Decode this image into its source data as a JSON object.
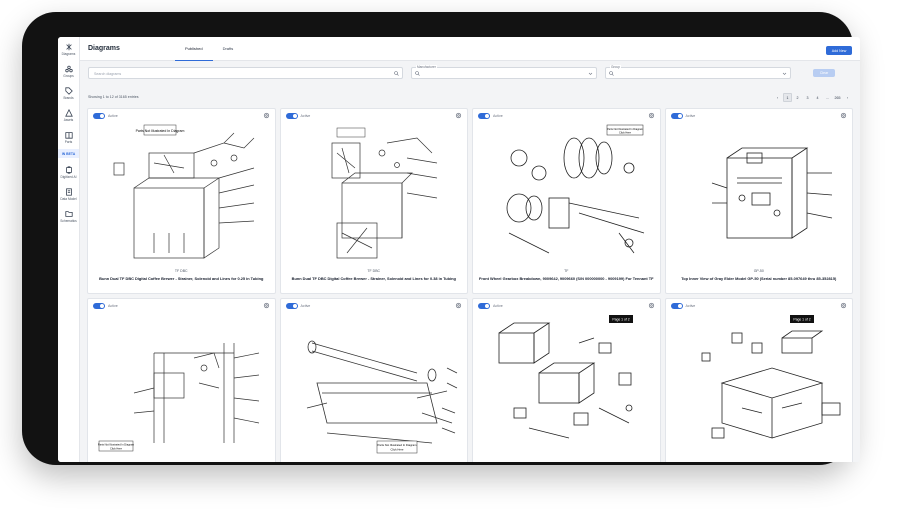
{
  "sidebar": {
    "items": [
      {
        "label": "Diagrams",
        "icon": "diagram-icon"
      },
      {
        "label": "Groups",
        "icon": "groups-icon"
      },
      {
        "label": "Brands",
        "icon": "tag-icon"
      },
      {
        "label": "Assets",
        "icon": "asset-icon"
      },
      {
        "label": "Parts",
        "icon": "book-icon"
      }
    ],
    "beta_label": "IN BETA",
    "beta_items": [
      {
        "label": "Digitized AI",
        "icon": "ai-icon"
      },
      {
        "label": "Data Model",
        "icon": "data-model-icon"
      },
      {
        "label": "Schematics",
        "icon": "folder-icon"
      }
    ]
  },
  "header": {
    "title": "Diagrams",
    "tabs": [
      {
        "label": "Published",
        "active": true
      },
      {
        "label": "Drafts",
        "active": false
      }
    ],
    "add_button": "Add New"
  },
  "filters": {
    "search_placeholder": "Search diagrams",
    "manufacturer_label": "Manufacturer",
    "group_label": "Group",
    "clear_button": "Clear"
  },
  "results": {
    "showing": "Showing 1 to 12 of 3165 entries",
    "pages": [
      "‹",
      "1",
      "2",
      "3",
      "4",
      "...",
      "265",
      "›"
    ],
    "current_page": "1"
  },
  "cards": [
    {
      "status": "Active",
      "code": "TF DBC",
      "name": "Bunn Dual TF DBC Digital Coffee Brewer - Strainer, Solenoid and Lines for 0.25 in Tubing",
      "drawing": "brewer"
    },
    {
      "status": "Active",
      "code": "TF DBC",
      "name": "Bunn Dual TF DBC Digital Coffee Brewer - Strainer, Solenoid and Lines for 0.38 in Tubing",
      "drawing": "brewer2"
    },
    {
      "status": "Active",
      "code": "TF",
      "name": "Front Wheel Gearbox Breakdown, 9009642, 9009660 (S/N 000000000 - 9009199) For Tennant TF",
      "drawing": "gearbox"
    },
    {
      "status": "Active",
      "code": "GP-50",
      "name": "Top Inner View of Gray Elder Model GP-50 (Serial number 85-097649 thru 85-352815)",
      "drawing": "cabinet"
    },
    {
      "status": "Active",
      "code": "",
      "name": "",
      "drawing": "frame"
    },
    {
      "status": "Active",
      "code": "",
      "name": "",
      "drawing": "roller"
    },
    {
      "status": "Active",
      "code": "",
      "name": "",
      "drawing": "electrical"
    },
    {
      "status": "Active",
      "code": "",
      "name": "",
      "drawing": "machine"
    }
  ],
  "callouts": {
    "parts_not_shown": "Parts Not Illustrated In Diagram",
    "click_here": "Click Here",
    "page_badge": "Page 1 of 2"
  },
  "colors": {
    "accent": "#2f6bd8",
    "device": "#121212",
    "background": "#f3f4f6"
  }
}
